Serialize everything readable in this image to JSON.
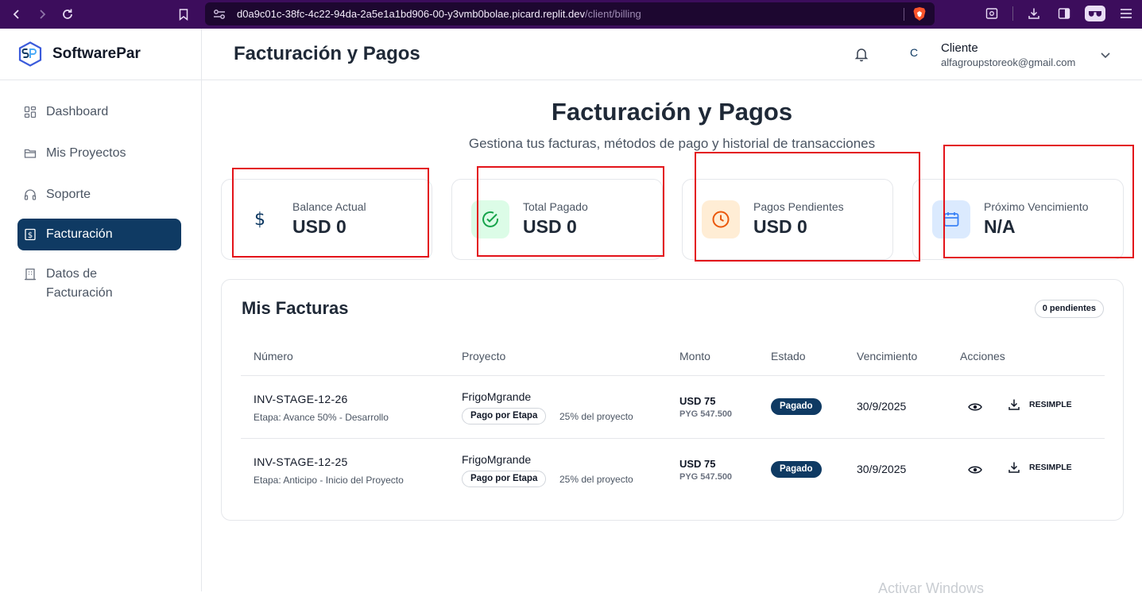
{
  "browser": {
    "url_host": "d0a9c01c-38fc-4c22-94da-2a5e1a1bd906-00-y3vmb0bolae.picard.replit.dev",
    "url_path": "/client/billing"
  },
  "brand": {
    "name": "SoftwarePar"
  },
  "sidebar": {
    "items": [
      {
        "label": "Dashboard",
        "icon": "dashboard-icon",
        "active": false
      },
      {
        "label": "Mis Proyectos",
        "icon": "folder-icon",
        "active": false
      },
      {
        "label": "Soporte",
        "icon": "headphones-icon",
        "active": false
      },
      {
        "label": "Facturación",
        "icon": "receipt-icon",
        "active": true
      },
      {
        "label": "Datos de Facturación",
        "icon": "building-icon",
        "active": false
      }
    ]
  },
  "header": {
    "title": "Facturación y Pagos",
    "avatar_initial": "C",
    "user_name": "Cliente",
    "user_email": "alfagroupstoreok@gmail.com"
  },
  "hero": {
    "title": "Facturación y Pagos",
    "subtitle": "Gestiona tus facturas, métodos de pago y historial de transacciones"
  },
  "stats": [
    {
      "label": "Balance Actual",
      "value": "USD 0",
      "icon": "dollar-icon",
      "color": "#0f3a63"
    },
    {
      "label": "Total Pagado",
      "value": "USD 0",
      "icon": "check-circle-icon",
      "color": "#16a34a"
    },
    {
      "label": "Pagos Pendientes",
      "value": "USD 0",
      "icon": "clock-icon",
      "color": "#ea580c"
    },
    {
      "label": "Próximo Vencimiento",
      "value": "N/A",
      "icon": "calendar-icon",
      "color": "#3b82f6"
    }
  ],
  "invoices": {
    "title": "Mis Facturas",
    "pending_badge": "0 pendientes",
    "columns": [
      "Número",
      "Proyecto",
      "Monto",
      "Estado",
      "Vencimiento",
      "Acciones"
    ],
    "rows": [
      {
        "number": "INV-STAGE-12-26",
        "stage": "Etapa: Avance 50% - Desarrollo",
        "project": "FrigoMgrande",
        "type": "Pago por Etapa",
        "percent": "25% del proyecto",
        "amount_usd": "USD 75",
        "amount_pyg": "PYG 547.500",
        "status": "Pagado",
        "due": "30/9/2025",
        "action_label": "RESIMPLE"
      },
      {
        "number": "INV-STAGE-12-25",
        "stage": "Etapa: Anticipo - Inicio del Proyecto",
        "project": "FrigoMgrande",
        "type": "Pago por Etapa",
        "percent": "25% del proyecto",
        "amount_usd": "USD 75",
        "amount_pyg": "PYG 547.500",
        "status": "Pagado",
        "due": "30/9/2025",
        "action_label": "RESIMPLE"
      }
    ]
  },
  "watermark": "Activar Windows",
  "colors": {
    "primary": "#0f3a63",
    "annotation_red": "#e3131a",
    "browser_frame": "#3c0d5c"
  }
}
